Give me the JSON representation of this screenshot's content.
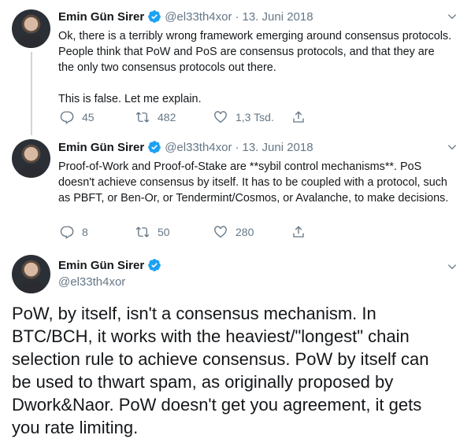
{
  "tweets": [
    {
      "name": "Emin Gün Sirer",
      "handle": "@el33th4xor",
      "date": "13. Juni 2018",
      "text": "Ok, there is a terribly wrong framework emerging around consensus protocols. People think that PoW and PoS are consensus protocols, and that they are the only two consensus protocols out there.\n\nThis is false. Let me explain.",
      "replies": "45",
      "retweets": "482",
      "likes": "1,3 Tsd."
    },
    {
      "name": "Emin Gün Sirer",
      "handle": "@el33th4xor",
      "date": "13. Juni 2018",
      "text": "Proof-of-Work and Proof-of-Stake are **sybil control mechanisms**. PoS doesn't achieve consensus by itself. It has to be coupled with a protocol, such as PBFT, or Ben-Or, or Tendermint/Cosmos, or Avalanche, to make decisions.",
      "replies": "8",
      "retweets": "50",
      "likes": "280"
    }
  ],
  "main_tweet": {
    "name": "Emin Gün Sirer",
    "handle": "@el33th4xor",
    "text": "PoW, by itself, isn't a consensus mechanism. In BTC/BCH, it works with the heaviest/\"longest\" chain selection rule to achieve consensus. PoW by itself can be used to thwart spam, as originally proposed by Dwork&Naor. PoW doesn't get you agreement, it gets you rate limiting."
  },
  "colors": {
    "verified": "#1da1f2",
    "secondary_text": "#657786",
    "thread_line": "#ccd6dd"
  },
  "icons": [
    "reply-icon",
    "retweet-icon",
    "like-icon",
    "share-icon",
    "verified-icon",
    "chevron-down-icon"
  ]
}
